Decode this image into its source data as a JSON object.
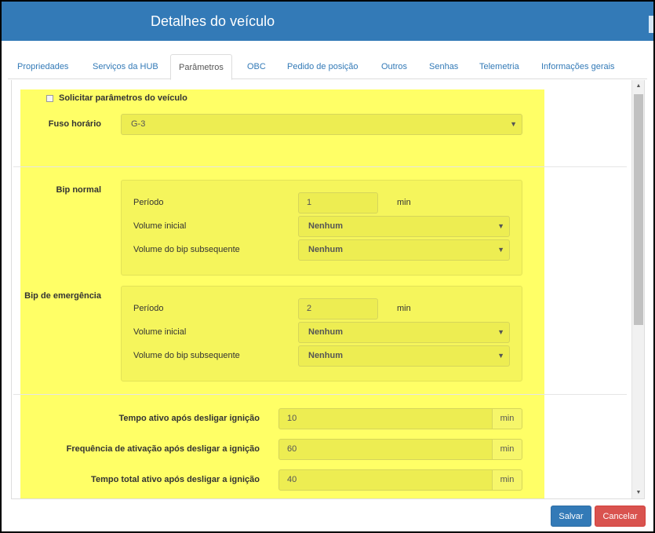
{
  "header": {
    "title": "Detalhes do veículo"
  },
  "tabs": [
    {
      "label": "Propriedades",
      "active": false
    },
    {
      "label": "Serviços da HUB",
      "active": false
    },
    {
      "label": "Parâmetros",
      "active": true
    },
    {
      "label": "OBC",
      "active": false
    },
    {
      "label": "Pedido de posição",
      "active": false
    },
    {
      "label": "Outros",
      "active": false
    },
    {
      "label": "Senhas",
      "active": false
    },
    {
      "label": "Telemetria",
      "active": false
    },
    {
      "label": "Informações gerais",
      "active": false
    }
  ],
  "params": {
    "request_label": "Solicitar parâmetros do veículo",
    "request_checked": false,
    "timezone_label": "Fuso horário",
    "timezone_value": "G-3"
  },
  "bip_normal": {
    "title": "Bip normal",
    "period_label": "Período",
    "period_value": "1",
    "period_unit": "min",
    "initial_volume_label": "Volume inicial",
    "initial_volume_value": "Nenhum",
    "subsequent_volume_label": "Volume do bip subsequente",
    "subsequent_volume_value": "Nenhum"
  },
  "bip_emergency": {
    "title": "Bip de emergência",
    "period_label": "Período",
    "period_value": "2",
    "period_unit": "min",
    "initial_volume_label": "Volume inicial",
    "initial_volume_value": "Nenhum",
    "subsequent_volume_label": "Volume do bip subsequente",
    "subsequent_volume_value": "Nenhum"
  },
  "ignition": {
    "active_time_label": "Tempo ativo após desligar ignição",
    "active_time_value": "10",
    "frequency_label": "Frequência de ativação após desligar a ignição",
    "frequency_value": "60",
    "total_time_label": "Tempo total ativo após desligar a ignição",
    "total_time_value": "40",
    "unit": "min"
  },
  "footer": {
    "save_label": "Salvar",
    "cancel_label": "Cancelar"
  },
  "colors": {
    "header": "#337ab7",
    "highlight": "#ffff66",
    "save": "#337ab7",
    "cancel": "#d9534f"
  },
  "icons": {
    "dropdown": "chevron-down-icon",
    "scroll_up": "scroll-up-arrow-icon",
    "scroll_down": "scroll-down-arrow-icon"
  }
}
